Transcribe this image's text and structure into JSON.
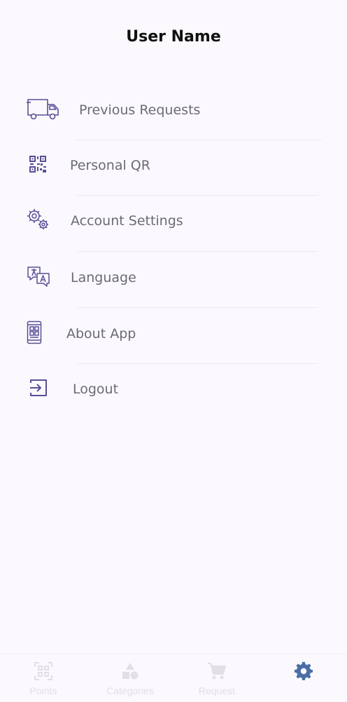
{
  "header": {
    "title": "User Name"
  },
  "menu": {
    "items": [
      {
        "label": "Previous Requests",
        "icon": "truck-icon"
      },
      {
        "label": "Personal QR",
        "icon": "qr-code-icon"
      },
      {
        "label": "Account Settings",
        "icon": "gears-icon"
      },
      {
        "label": "Language",
        "icon": "translate-icon"
      },
      {
        "label": "About App",
        "icon": "phone-info-icon"
      },
      {
        "label": "Logout",
        "icon": "logout-icon"
      }
    ]
  },
  "bottom_nav": {
    "items": [
      {
        "label": "Points",
        "icon": "qr-scan-icon"
      },
      {
        "label": "Categories",
        "icon": "shapes-icon"
      },
      {
        "label": "Request",
        "icon": "cart-icon"
      },
      {
        "label": "",
        "icon": "gear-icon",
        "active": true
      }
    ]
  },
  "colors": {
    "accent": "#5a4e96",
    "active_nav": "#4a6fa5",
    "inactive_nav": "#e2dfe6",
    "background": "#fbf9fd"
  }
}
